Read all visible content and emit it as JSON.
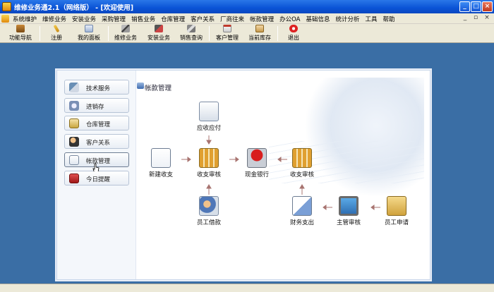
{
  "window": {
    "title": "维修业务通2.1（网络版） - [欢迎使用]"
  },
  "menu": {
    "items": [
      "系统维护",
      "维修业务",
      "安装业务",
      "采购管理",
      "销售业务",
      "仓库管理",
      "客户关系",
      "厂商往来",
      "帐款管理",
      "办公OA",
      "基础信息",
      "统计分析",
      "工具",
      "帮助"
    ]
  },
  "toolbar": {
    "items": [
      {
        "label": "功能导航",
        "icon": "navigation-icon"
      },
      {
        "label": "注册",
        "icon": "register-icon"
      },
      {
        "label": "我的面板",
        "icon": "my-panel-icon"
      },
      {
        "label": "维修业务",
        "icon": "repair-icon"
      },
      {
        "label": "安装业务",
        "icon": "install-icon"
      },
      {
        "label": "销售查询",
        "icon": "sales-query-icon"
      },
      {
        "label": "客户管理",
        "icon": "customer-icon"
      },
      {
        "label": "当前库存",
        "icon": "inventory-icon"
      },
      {
        "label": "退出",
        "icon": "exit-icon"
      }
    ]
  },
  "nav": {
    "items": [
      {
        "label": "技术服务",
        "icon": "tools-icon",
        "active": false
      },
      {
        "label": "进销存",
        "icon": "package-icon",
        "active": false
      },
      {
        "label": "仓库管理",
        "icon": "warehouse-icon",
        "active": false
      },
      {
        "label": "客户关系",
        "icon": "people-icon",
        "active": false
      },
      {
        "label": "帐款管理",
        "icon": "ledger-icon",
        "active": true
      },
      {
        "label": "今日提醒",
        "icon": "reminder-icon",
        "active": false
      }
    ]
  },
  "section": {
    "title": "帐款管理"
  },
  "flow": {
    "receivable": "应收应付",
    "new_income": "新建收支",
    "review1": "收支审核",
    "cash_bank": "现金银行",
    "review2": "收支审核",
    "employee_loan": "员工借款",
    "finance_expense": "财务支出",
    "supervisor_review": "主管审核",
    "employee_apply": "员工申请"
  },
  "colors": {
    "title_bar": "#0a53d6",
    "desktop": "#3a6ea5",
    "arrow": "#a87470"
  }
}
